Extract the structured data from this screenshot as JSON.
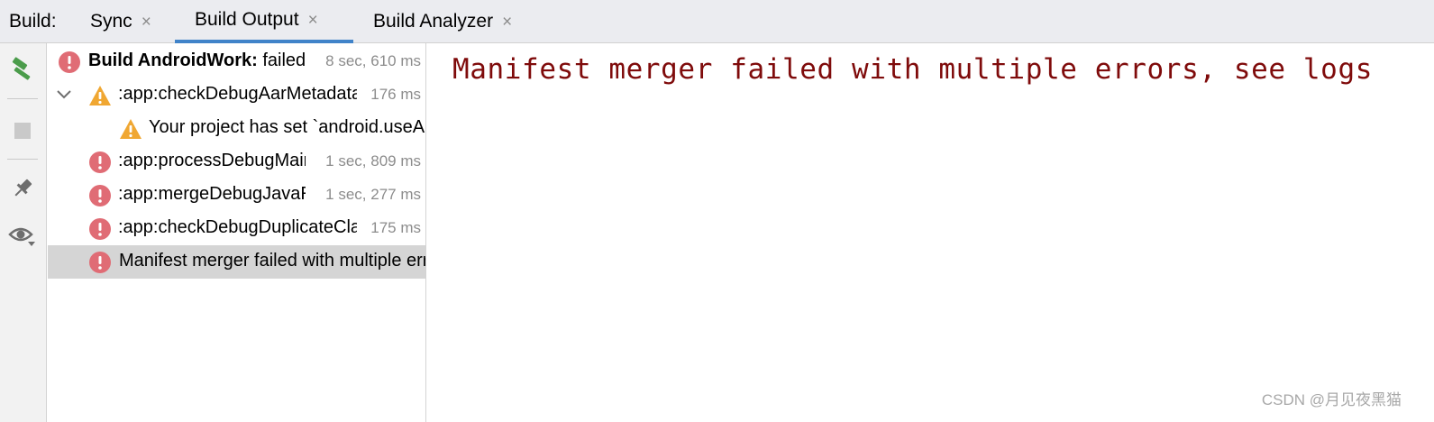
{
  "tabbar": {
    "label": "Build:",
    "tabs": [
      {
        "label": "Sync",
        "close": "×",
        "active": false
      },
      {
        "label": "Build Output",
        "close": "×",
        "active": true
      },
      {
        "label": "Build Analyzer",
        "close": "×",
        "active": false
      }
    ]
  },
  "toolbar": {
    "buttons": [
      {
        "icon": "hammer-icon",
        "enabled": true
      },
      {
        "icon": "stop-icon",
        "enabled": false
      },
      {
        "icon": "pin-icon",
        "enabled": true
      },
      {
        "icon": "eye-icon",
        "enabled": true
      }
    ]
  },
  "tree": {
    "rows": [
      {
        "icon": "error-icon",
        "label_bold": "Build AndroidWork:",
        "label": " failed",
        "duration": "8 sec, 610 ms"
      },
      {
        "icon": "warning-icon",
        "expanded": true,
        "label": ":app:checkDebugAarMetadata",
        "duration": "176 ms"
      },
      {
        "icon": "warning-icon",
        "label": "Your project has set `android.useAndroidX=true`",
        "duration": ""
      },
      {
        "icon": "error-icon",
        "label": ":app:processDebugMainManifest",
        "duration": "1 sec, 809 ms"
      },
      {
        "icon": "error-icon",
        "label": ":app:mergeDebugJavaResource",
        "duration": "1 sec, 277 ms"
      },
      {
        "icon": "error-icon",
        "label": ":app:checkDebugDuplicateClasses",
        "duration": "175 ms"
      },
      {
        "icon": "error-icon",
        "label": "Manifest merger failed with multiple errors, see logs",
        "duration": "",
        "selected": true
      }
    ]
  },
  "console": {
    "text": "Manifest merger failed with multiple errors, see logs",
    "color": "#7f0b0b"
  },
  "watermark": "CSDN @月见夜黑猫",
  "colors": {
    "accent": "#4083c9",
    "error": "#e06c75",
    "warning": "#f0a732",
    "hammer": "#4b9c4b"
  }
}
